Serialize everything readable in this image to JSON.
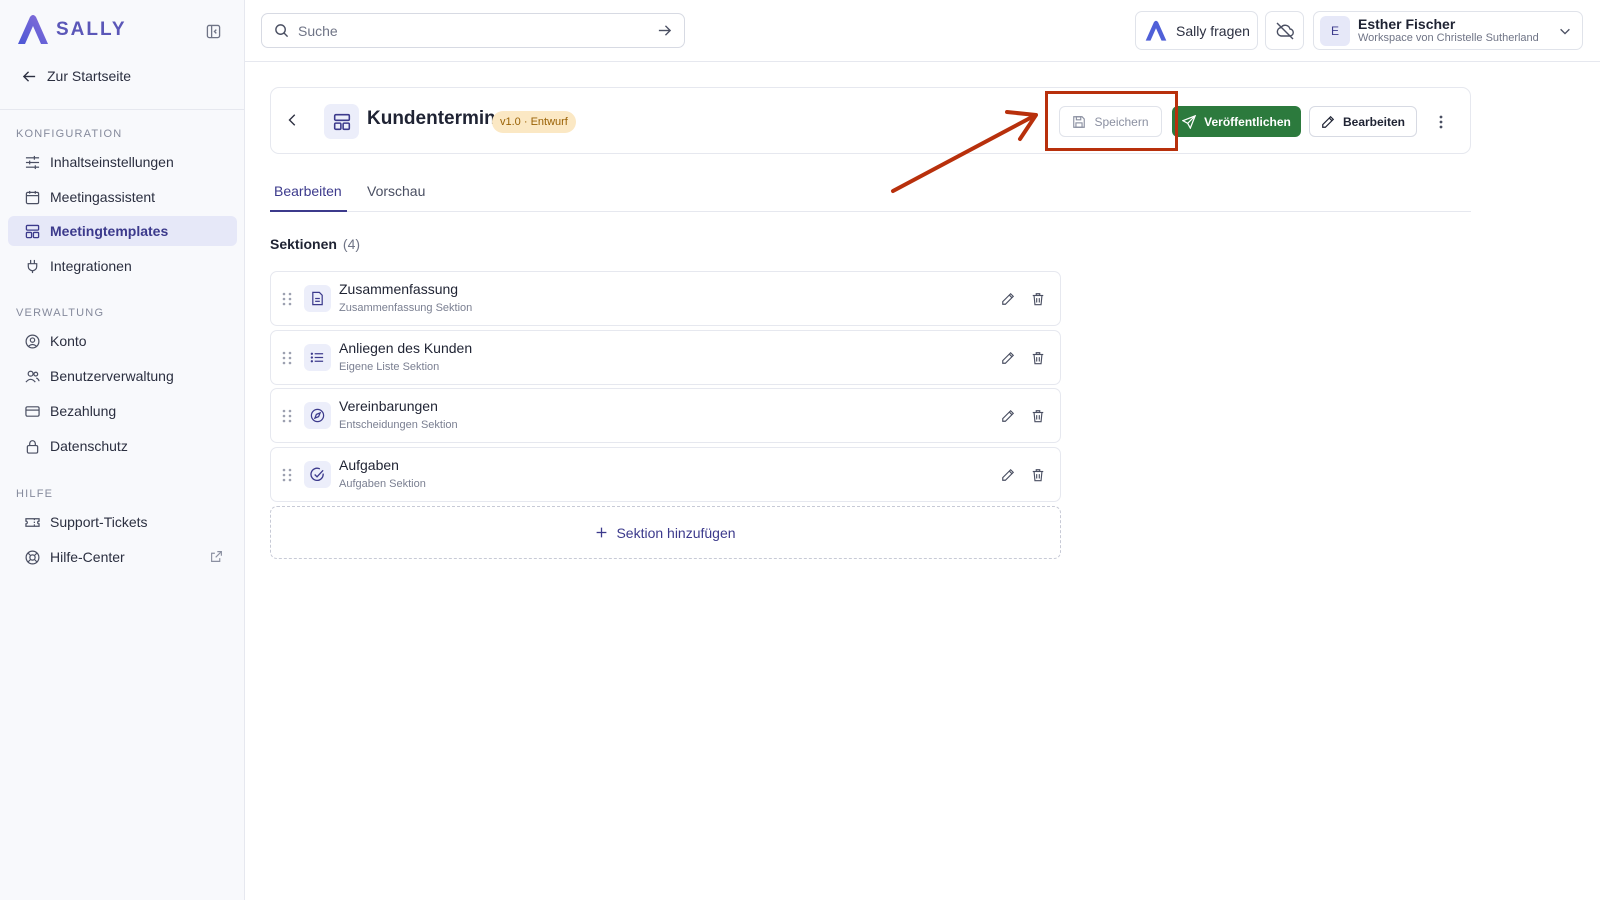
{
  "app": {
    "brand": "SALLY"
  },
  "sidebar": {
    "home_label": "Zur Startseite",
    "groups": [
      {
        "label": "KONFIGURATION",
        "items": [
          {
            "label": "Inhaltseinstellungen",
            "icon": "sliders-icon"
          },
          {
            "label": "Meetingassistent",
            "icon": "calendar-icon"
          },
          {
            "label": "Meetingtemplates",
            "icon": "template-icon",
            "active": true
          },
          {
            "label": "Integrationen",
            "icon": "plug-icon"
          }
        ]
      },
      {
        "label": "VERWALTUNG",
        "items": [
          {
            "label": "Konto",
            "icon": "user-circle-icon"
          },
          {
            "label": "Benutzerverwaltung",
            "icon": "users-icon"
          },
          {
            "label": "Bezahlung",
            "icon": "credit-card-icon"
          },
          {
            "label": "Datenschutz",
            "icon": "lock-icon"
          }
        ]
      },
      {
        "label": "HILFE",
        "items": [
          {
            "label": "Support-Tickets",
            "icon": "ticket-icon"
          },
          {
            "label": "Hilfe-Center",
            "icon": "lifebuoy-icon",
            "external": true
          }
        ]
      }
    ]
  },
  "topbar": {
    "search_placeholder": "Suche",
    "ask_label": "Sally fragen",
    "user": {
      "initial": "E",
      "name": "Esther Fischer",
      "workspace": "Workspace von Christelle Sutherland"
    }
  },
  "template": {
    "title": "Kundentermin",
    "badge": "v1.0 · Entwurf",
    "save_label": "Speichern",
    "publish_label": "Veröffentlichen",
    "edit_label": "Bearbeiten"
  },
  "tabs": [
    {
      "label": "Bearbeiten",
      "active": true
    },
    {
      "label": "Vorschau",
      "active": false
    }
  ],
  "sections": {
    "heading": "Sektionen",
    "count": "(4)",
    "items": [
      {
        "title": "Zusammenfassung",
        "subtitle": "Zusammenfassung Sektion",
        "icon": "document-icon"
      },
      {
        "title": "Anliegen des Kunden",
        "subtitle": "Eigene Liste Sektion",
        "icon": "list-icon"
      },
      {
        "title": "Vereinbarungen",
        "subtitle": "Entscheidungen Sektion",
        "icon": "compass-icon"
      },
      {
        "title": "Aufgaben",
        "subtitle": "Aufgaben Sektion",
        "icon": "check-circle-icon"
      }
    ],
    "add_label": "Sektion hinzufügen"
  },
  "colors": {
    "accent": "#3c3a8c",
    "publish": "#2c7a3d",
    "badge_bg": "#fbe8c4",
    "annotation": "#b8300c"
  }
}
